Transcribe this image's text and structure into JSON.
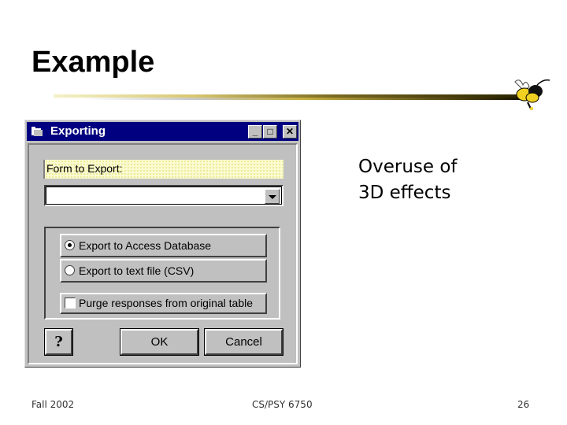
{
  "slide": {
    "title": "Example",
    "callout_line1": "Overuse of",
    "callout_line2": "3D effects",
    "footer_left": "Fall 2002",
    "footer_center": "CS/PSY 6750",
    "footer_right": "26"
  },
  "dialog": {
    "title": "Exporting",
    "minimize_glyph": "_",
    "maximize_glyph": "□",
    "close_glyph": "✕",
    "form_label": "Form to Export:",
    "form_combo_value": "",
    "options": [
      {
        "label": "Export to Access Database",
        "selected": true
      },
      {
        "label": "Export to text file (CSV)",
        "selected": false
      }
    ],
    "purge_label": "Purge responses from original table",
    "purge_checked": false,
    "help_glyph": "?",
    "ok_label": "OK",
    "cancel_label": "Cancel"
  },
  "colors": {
    "titlebar": "#000080",
    "dialog_face": "#c0c0c0",
    "label_highlight": "#fafad0"
  }
}
